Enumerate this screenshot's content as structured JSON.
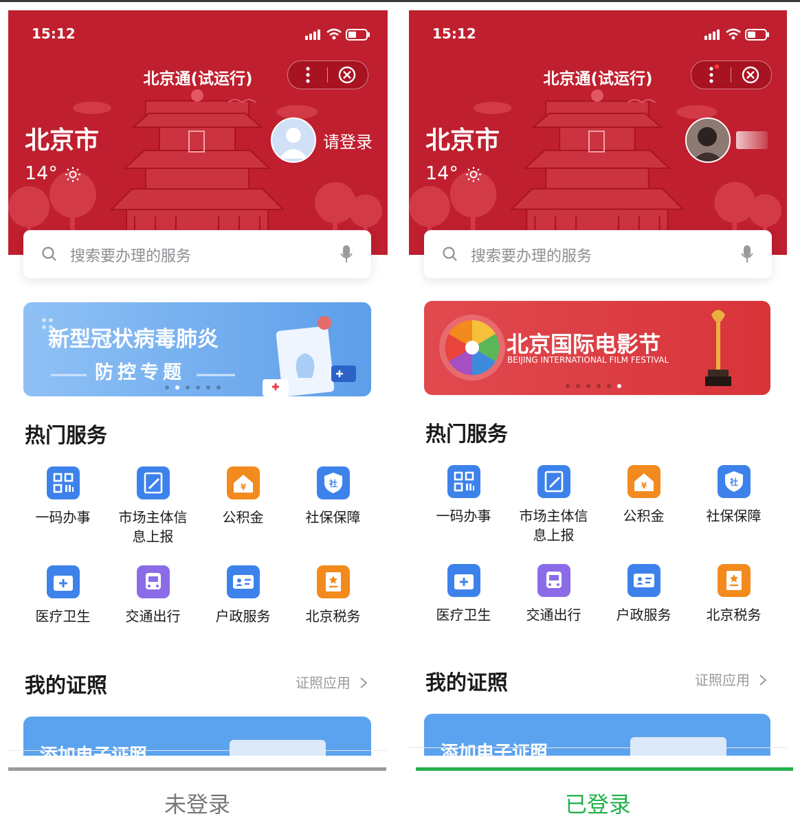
{
  "left": {
    "status_time": "15:12",
    "app_title": "北京通(试运行)",
    "city": "北京市",
    "weather": "14°",
    "login_label": "请登录",
    "search_placeholder": "搜索要办理的服务",
    "banner_title": "新型冠状病毒肺炎",
    "banner_subtitle": "防控专题",
    "hot_title": "热门服务",
    "services": [
      "一码办事",
      "市场主体信息上报",
      "公积金",
      "社保保障",
      "医疗卫生",
      "交通出行",
      "户政服务",
      "北京税务"
    ],
    "cert_title": "我的证照",
    "cert_link": "证照应用",
    "cert_card_text": "添加电子证照",
    "caption": "未登录"
  },
  "right": {
    "status_time": "15:12",
    "app_title": "北京通(试运行)",
    "city": "北京市",
    "weather": "14°",
    "search_placeholder": "搜索要办理的服务",
    "banner_title": "北京国际电影节",
    "banner_subtitle": "BEIJING INTERNATIONAL FILM FESTIVAL",
    "hot_title": "热门服务",
    "services": [
      "一码办事",
      "市场主体信息上报",
      "公积金",
      "社保保障",
      "医疗卫生",
      "交通出行",
      "户政服务",
      "北京税务"
    ],
    "cert_title": "我的证照",
    "cert_link": "证照应用",
    "cert_card_text": "添加电子证照",
    "caption": "已登录"
  },
  "colors": {
    "hero_red": "#bf1f2e",
    "caption_gray": "#777777",
    "caption_green": "#22b14c",
    "tab_gray": "#9a9a9a",
    "tab_green": "#22b14c"
  }
}
